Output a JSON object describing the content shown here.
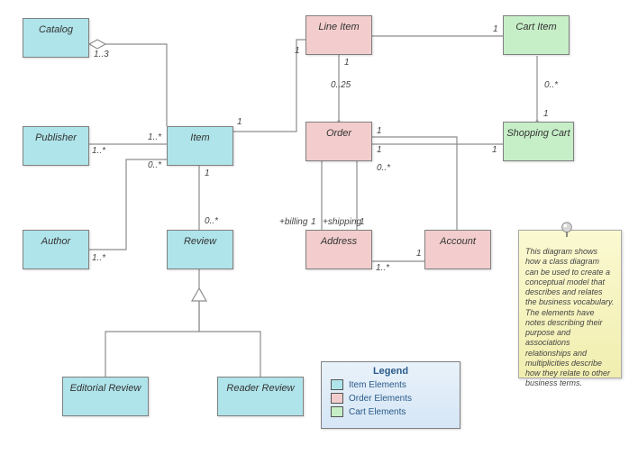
{
  "nodes": {
    "catalog": "Catalog",
    "publisher": "Publisher",
    "item": "Item",
    "author": "Author",
    "review": "Review",
    "editorial_review": "Editorial Review",
    "reader_review": "Reader Review",
    "line_item": "Line Item",
    "order": "Order",
    "address": "Address",
    "account": "Account",
    "cart_item": "Cart Item",
    "shopping_cart": "Shopping Cart"
  },
  "multiplicities": {
    "catalog_item": "1..3",
    "publisher_1": "1..*",
    "item_publisher": "1..*",
    "item_author": "0..*",
    "author_1": "1..*",
    "item_review_top": "1",
    "item_review_bottom": "0..*",
    "item_lineitem_left": "1",
    "lineitem_item_right": "1",
    "lineitem_order": "0..25",
    "order_lineitem": "1",
    "order_account_left": "1",
    "order_account_right": "0..*",
    "order_billing": "1",
    "order_shipping": "1",
    "billing_label": "+billing",
    "shipping_label": "+shipping",
    "account_address_top": "1",
    "account_address_bottom": "1..*",
    "order_cart_left": "1",
    "order_cart_right": "1",
    "cartitem_item": "1",
    "cartitem_cart_top": "0..*",
    "cartitem_cart_bottom": "1"
  },
  "legend": {
    "title": "Legend",
    "items": "Item Elements",
    "orders": "Order Elements",
    "carts": "Cart Elements"
  },
  "sticky": "This diagram shows how a class diagram can be used to create a conceptual model that describes and relates the business vocabulary. The elements have notes describing their purpose and associations relationships and multiplicities describe how they relate to other business terms.",
  "colors": {
    "item": "#afe4ea",
    "order": "#f3cdcd",
    "cart": "#c6eec7",
    "connector": "#8d8d8d"
  }
}
